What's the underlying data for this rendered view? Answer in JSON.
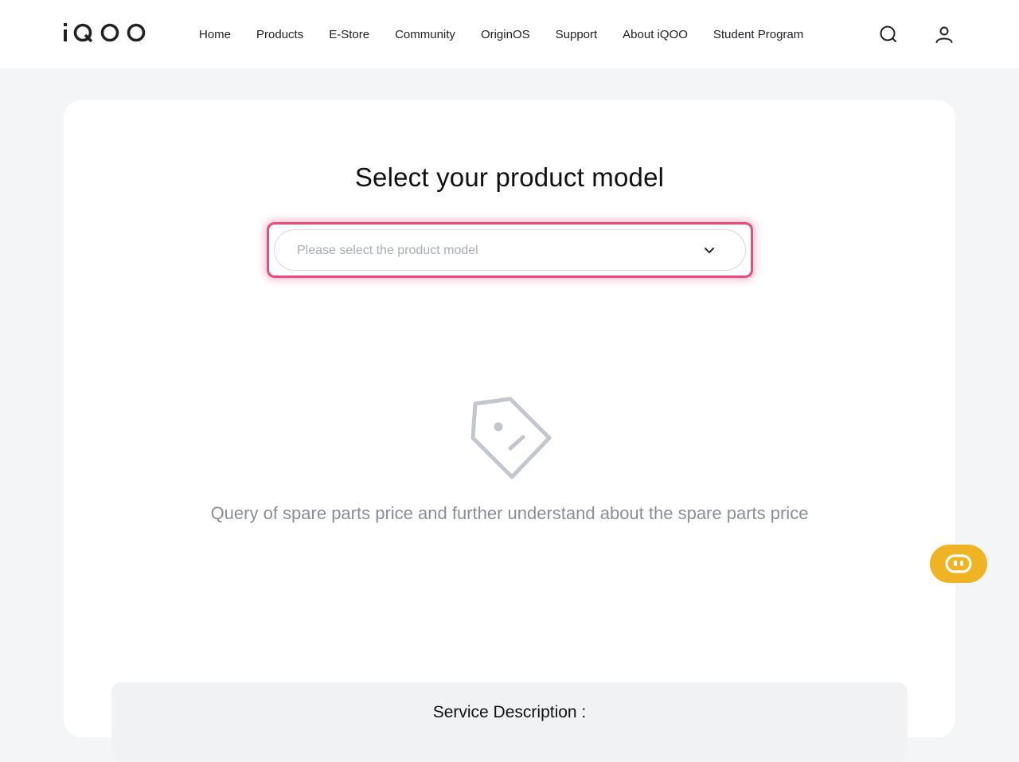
{
  "header": {
    "logo_text": "iQOO",
    "nav": [
      {
        "label": "Home"
      },
      {
        "label": "Products"
      },
      {
        "label": "E-Store"
      },
      {
        "label": "Community"
      },
      {
        "label": "OriginOS"
      },
      {
        "label": "Support"
      },
      {
        "label": "About iQOO"
      },
      {
        "label": "Student Program"
      }
    ],
    "icons": {
      "search": "search-icon",
      "user": "user-icon"
    }
  },
  "main": {
    "title": "Select your product model",
    "select": {
      "placeholder": "Please select the product model",
      "value": "",
      "icon": "chevron-down-icon",
      "focus_color": "#ec4a7c"
    },
    "empty_state": {
      "icon": "price-tag-icon",
      "text": "Query of spare parts price and further understand about the spare parts price"
    },
    "service": {
      "title": "Service Description :"
    }
  },
  "floating": {
    "chat_icon": "chat-robot-icon",
    "color": "#f0b323"
  }
}
